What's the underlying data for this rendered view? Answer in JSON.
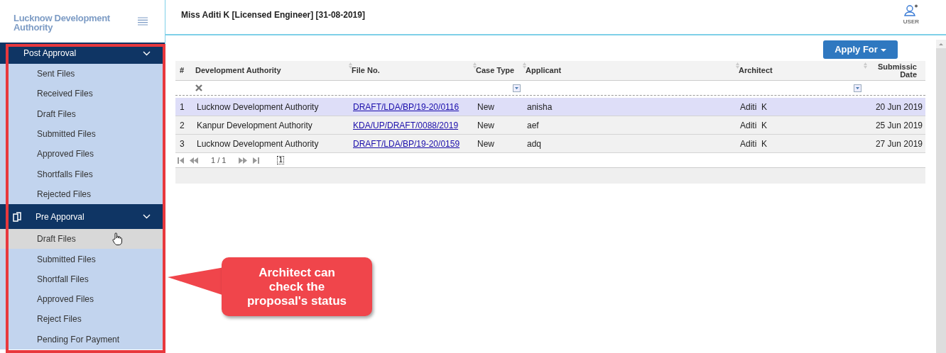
{
  "sidebar": {
    "title": "Lucknow Development Authority",
    "sections": [
      {
        "title": "Post Approval",
        "icon": false,
        "expanded": true,
        "items": [
          {
            "label": "Sent Files",
            "hovered": false
          },
          {
            "label": "Received Files",
            "hovered": false
          },
          {
            "label": "Draft Files",
            "hovered": false
          },
          {
            "label": "Submitted Files",
            "hovered": false
          },
          {
            "label": "Approved Files",
            "hovered": false
          },
          {
            "label": "Shortfalls Files",
            "hovered": false
          },
          {
            "label": "Rejected Files",
            "hovered": false
          }
        ]
      },
      {
        "title": "Pre Apporval",
        "icon": true,
        "expanded": true,
        "items": [
          {
            "label": "Draft Files",
            "hovered": true
          },
          {
            "label": "Submitted Files",
            "hovered": false
          },
          {
            "label": "Shortfall Files",
            "hovered": false
          },
          {
            "label": "Approved Files",
            "hovered": false
          },
          {
            "label": "Reject Files",
            "hovered": false
          },
          {
            "label": "Pending For Payment",
            "hovered": false
          }
        ]
      }
    ]
  },
  "header": {
    "title": "Miss Aditi K [Licensed Engineer] [31-08-2019]",
    "user_label": "USER"
  },
  "apply_button": "Apply For",
  "table": {
    "columns": [
      "#",
      "Development Authority",
      "File No.",
      "Case Type",
      "Applicant",
      "Architect",
      "Submissic Date"
    ],
    "rows": [
      {
        "selected": true,
        "cells": [
          "1",
          "Lucknow Development Authority",
          "DRAFT/LDA/BP/19-20/0116",
          "New",
          "anisha",
          "Aditi  K",
          "20 Jun 2019"
        ]
      },
      {
        "selected": false,
        "cells": [
          "2",
          "Kanpur Development Authority",
          "KDA/UP/DRAFT/0088/2019",
          "New",
          "aef",
          "Aditi  K",
          "25 Jun 2019"
        ]
      },
      {
        "selected": false,
        "cells": [
          "3",
          "Lucknow Development Authority",
          "DRAFT/LDA/BP/19-20/0159",
          "New",
          "adq",
          "Aditi  K",
          "27 Jun 2019"
        ]
      }
    ],
    "pager": {
      "page_info": "1 / 1",
      "page_select": "1"
    }
  },
  "callout": "Architect can check the proposal's status"
}
